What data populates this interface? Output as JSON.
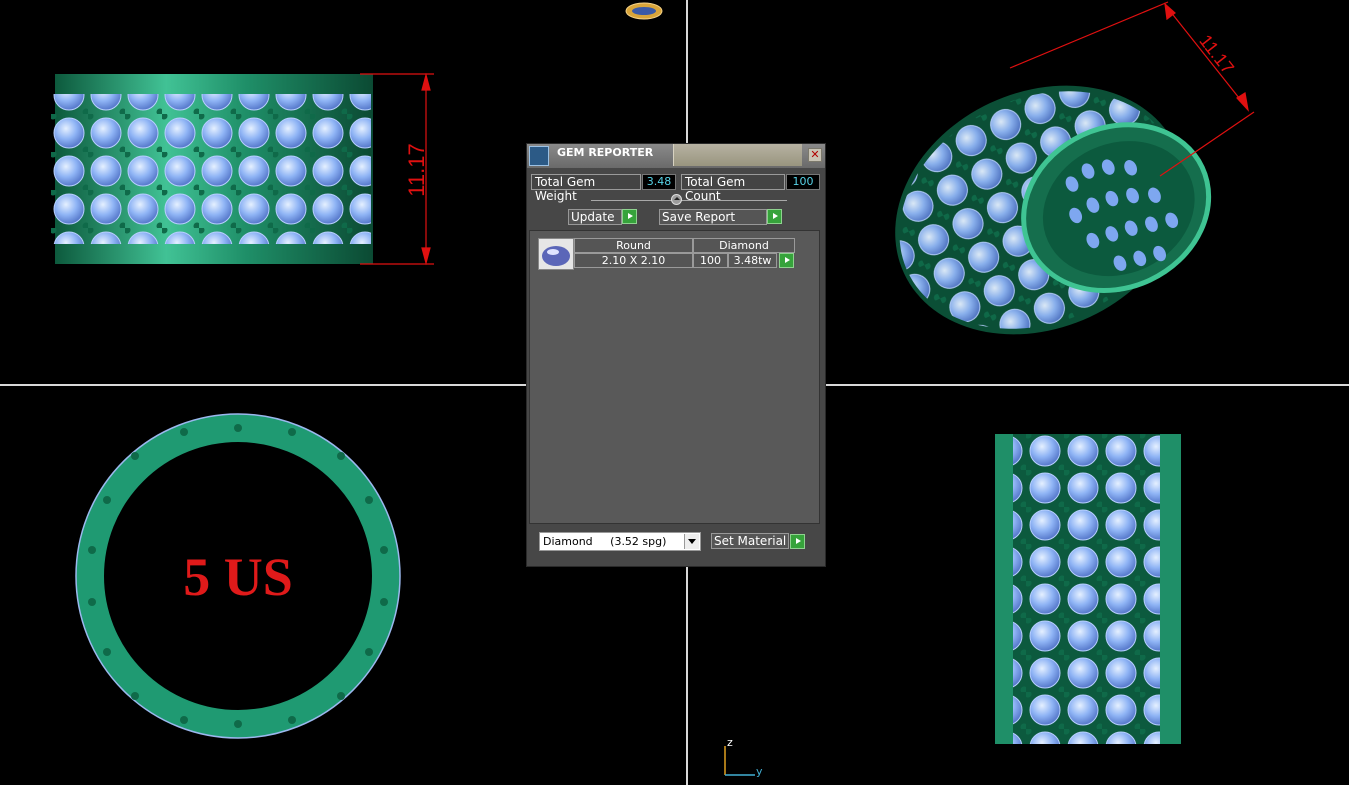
{
  "viewports": {
    "top_left": {
      "dimension": "11.17"
    },
    "top_right": {
      "dimension": "11.17"
    },
    "bottom_left": {
      "ring_size": "5 US"
    },
    "axes": {
      "z": "z",
      "y": "y"
    }
  },
  "dialog": {
    "title": "GEM REPORTER",
    "close_symbol": "✕",
    "total_weight_label": "Total Gem Weight",
    "total_weight_value": "3.48",
    "total_count_label": "Total Gem Count",
    "total_count_value": "100",
    "update_label": "Update",
    "save_report_label": "Save Report",
    "gems": [
      {
        "shape": "Round",
        "type": "Diamond",
        "size": "2.10 X 2.10",
        "count": "100",
        "weight": "3.48tw"
      }
    ],
    "material_selected": "Diamond     (3.52 spg)",
    "set_material_label": "Set Material"
  },
  "colors": {
    "metal": "#1f8f68",
    "gem": "#7ea7f0",
    "dimension": "#e01010",
    "axis_z": "#e0a020",
    "axis_y": "#43b0d4"
  }
}
